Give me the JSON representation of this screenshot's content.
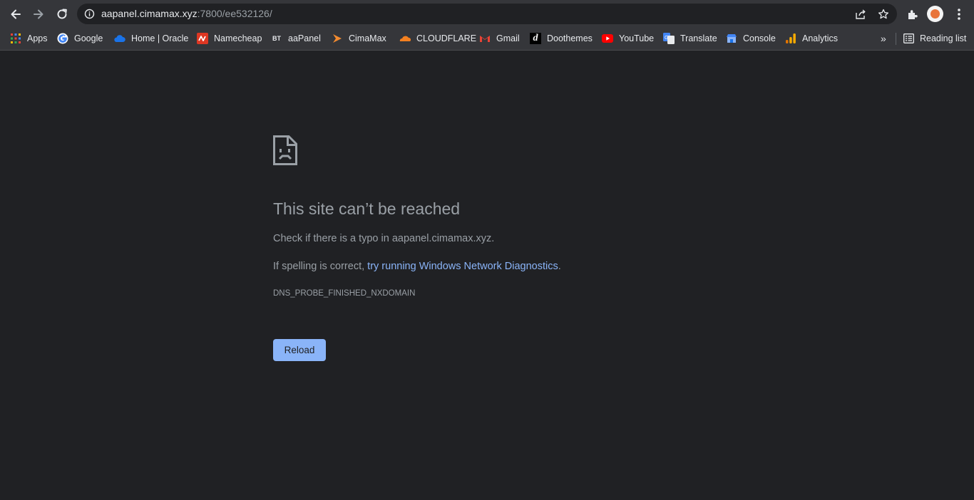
{
  "browser": {
    "url_host": "aapanel.cimamax.xyz",
    "url_rest": ":7800/ee532126/"
  },
  "bookmarks": [
    {
      "label": "Apps",
      "icon": "apps-grid-icon"
    },
    {
      "label": "Google",
      "icon": "google-icon"
    },
    {
      "label": "Home | Oracle",
      "icon": "oracle-cloud-icon"
    },
    {
      "label": "Namecheap",
      "icon": "namecheap-icon"
    },
    {
      "label": "aaPanel",
      "icon": "bt-icon"
    },
    {
      "label": "CimaMax",
      "icon": "cimamax-icon"
    },
    {
      "label": "CLOUDFLARE",
      "icon": "cloudflare-icon"
    },
    {
      "label": "Gmail",
      "icon": "gmail-icon"
    },
    {
      "label": "Doothemes",
      "icon": "doothemes-icon"
    },
    {
      "label": "YouTube",
      "icon": "youtube-icon"
    },
    {
      "label": "Translate",
      "icon": "translate-icon"
    },
    {
      "label": "Console",
      "icon": "console-icon"
    },
    {
      "label": "Analytics",
      "icon": "analytics-icon"
    }
  ],
  "bookmark_icon_text": {
    "bt": "BT",
    "doothemes": "d"
  },
  "reading_list": "Reading list",
  "overflow": "»",
  "error": {
    "title": "This site can’t be reached",
    "typo_check": "Check if there is a typo in aapanel.cimamax.xyz.",
    "spelling_prefix": "If spelling is correct, ",
    "diagnostics_link": "try running Windows Network Diagnostics",
    "spelling_suffix": ".",
    "code": "DNS_PROBE_FINISHED_NXDOMAIN",
    "reload_label": "Reload"
  },
  "colors": {
    "page_bg": "#202124",
    "toolbar_bg": "#35363a",
    "text_muted": "#9aa0a6",
    "link": "#8ab4f8",
    "button_bg": "#8ab4f8"
  }
}
